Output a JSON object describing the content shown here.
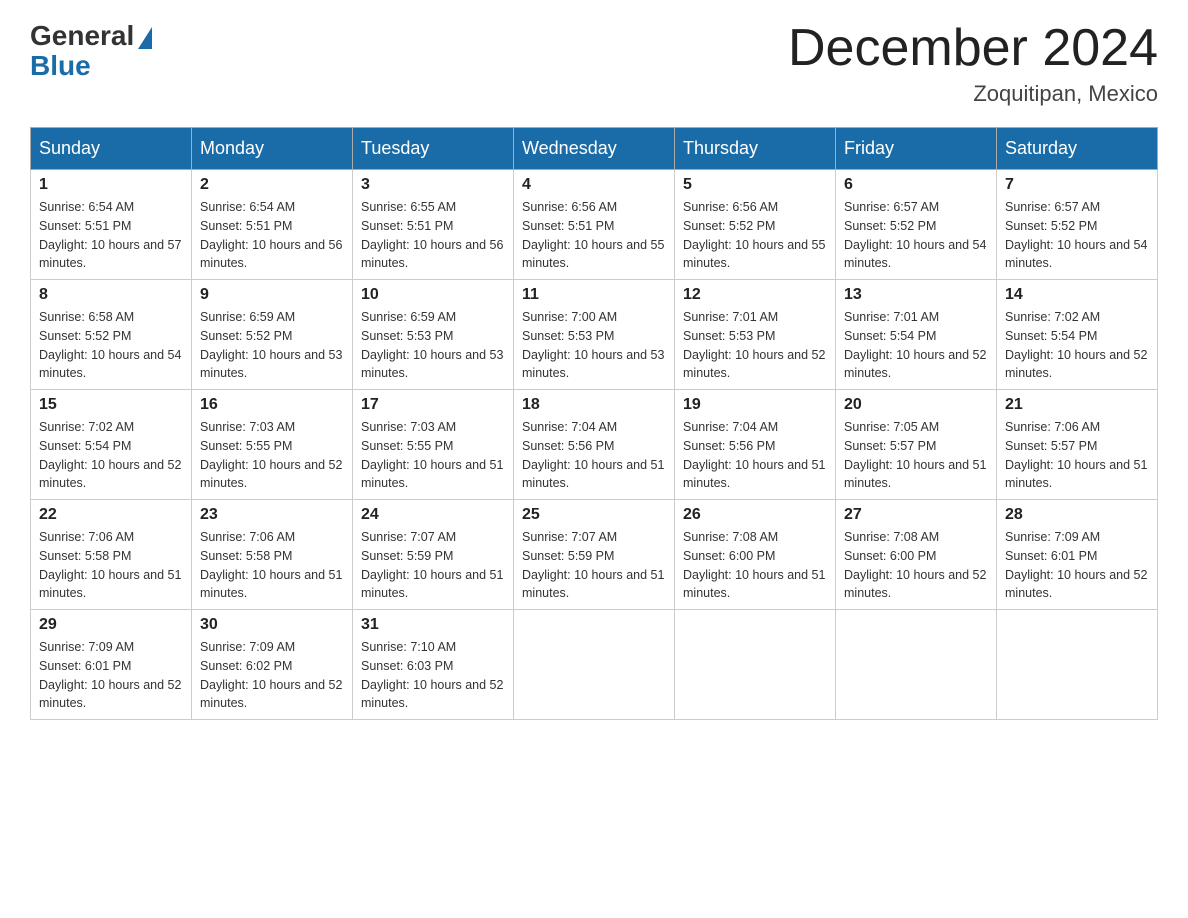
{
  "header": {
    "logo_general": "General",
    "logo_blue": "Blue",
    "month_title": "December 2024",
    "location": "Zoquitipan, Mexico"
  },
  "days_of_week": [
    "Sunday",
    "Monday",
    "Tuesday",
    "Wednesday",
    "Thursday",
    "Friday",
    "Saturday"
  ],
  "weeks": [
    [
      {
        "day": "1",
        "sunrise": "6:54 AM",
        "sunset": "5:51 PM",
        "daylight": "10 hours and 57 minutes."
      },
      {
        "day": "2",
        "sunrise": "6:54 AM",
        "sunset": "5:51 PM",
        "daylight": "10 hours and 56 minutes."
      },
      {
        "day": "3",
        "sunrise": "6:55 AM",
        "sunset": "5:51 PM",
        "daylight": "10 hours and 56 minutes."
      },
      {
        "day": "4",
        "sunrise": "6:56 AM",
        "sunset": "5:51 PM",
        "daylight": "10 hours and 55 minutes."
      },
      {
        "day": "5",
        "sunrise": "6:56 AM",
        "sunset": "5:52 PM",
        "daylight": "10 hours and 55 minutes."
      },
      {
        "day": "6",
        "sunrise": "6:57 AM",
        "sunset": "5:52 PM",
        "daylight": "10 hours and 54 minutes."
      },
      {
        "day": "7",
        "sunrise": "6:57 AM",
        "sunset": "5:52 PM",
        "daylight": "10 hours and 54 minutes."
      }
    ],
    [
      {
        "day": "8",
        "sunrise": "6:58 AM",
        "sunset": "5:52 PM",
        "daylight": "10 hours and 54 minutes."
      },
      {
        "day": "9",
        "sunrise": "6:59 AM",
        "sunset": "5:52 PM",
        "daylight": "10 hours and 53 minutes."
      },
      {
        "day": "10",
        "sunrise": "6:59 AM",
        "sunset": "5:53 PM",
        "daylight": "10 hours and 53 minutes."
      },
      {
        "day": "11",
        "sunrise": "7:00 AM",
        "sunset": "5:53 PM",
        "daylight": "10 hours and 53 minutes."
      },
      {
        "day": "12",
        "sunrise": "7:01 AM",
        "sunset": "5:53 PM",
        "daylight": "10 hours and 52 minutes."
      },
      {
        "day": "13",
        "sunrise": "7:01 AM",
        "sunset": "5:54 PM",
        "daylight": "10 hours and 52 minutes."
      },
      {
        "day": "14",
        "sunrise": "7:02 AM",
        "sunset": "5:54 PM",
        "daylight": "10 hours and 52 minutes."
      }
    ],
    [
      {
        "day": "15",
        "sunrise": "7:02 AM",
        "sunset": "5:54 PM",
        "daylight": "10 hours and 52 minutes."
      },
      {
        "day": "16",
        "sunrise": "7:03 AM",
        "sunset": "5:55 PM",
        "daylight": "10 hours and 52 minutes."
      },
      {
        "day": "17",
        "sunrise": "7:03 AM",
        "sunset": "5:55 PM",
        "daylight": "10 hours and 51 minutes."
      },
      {
        "day": "18",
        "sunrise": "7:04 AM",
        "sunset": "5:56 PM",
        "daylight": "10 hours and 51 minutes."
      },
      {
        "day": "19",
        "sunrise": "7:04 AM",
        "sunset": "5:56 PM",
        "daylight": "10 hours and 51 minutes."
      },
      {
        "day": "20",
        "sunrise": "7:05 AM",
        "sunset": "5:57 PM",
        "daylight": "10 hours and 51 minutes."
      },
      {
        "day": "21",
        "sunrise": "7:06 AM",
        "sunset": "5:57 PM",
        "daylight": "10 hours and 51 minutes."
      }
    ],
    [
      {
        "day": "22",
        "sunrise": "7:06 AM",
        "sunset": "5:58 PM",
        "daylight": "10 hours and 51 minutes."
      },
      {
        "day": "23",
        "sunrise": "7:06 AM",
        "sunset": "5:58 PM",
        "daylight": "10 hours and 51 minutes."
      },
      {
        "day": "24",
        "sunrise": "7:07 AM",
        "sunset": "5:59 PM",
        "daylight": "10 hours and 51 minutes."
      },
      {
        "day": "25",
        "sunrise": "7:07 AM",
        "sunset": "5:59 PM",
        "daylight": "10 hours and 51 minutes."
      },
      {
        "day": "26",
        "sunrise": "7:08 AM",
        "sunset": "6:00 PM",
        "daylight": "10 hours and 51 minutes."
      },
      {
        "day": "27",
        "sunrise": "7:08 AM",
        "sunset": "6:00 PM",
        "daylight": "10 hours and 52 minutes."
      },
      {
        "day": "28",
        "sunrise": "7:09 AM",
        "sunset": "6:01 PM",
        "daylight": "10 hours and 52 minutes."
      }
    ],
    [
      {
        "day": "29",
        "sunrise": "7:09 AM",
        "sunset": "6:01 PM",
        "daylight": "10 hours and 52 minutes."
      },
      {
        "day": "30",
        "sunrise": "7:09 AM",
        "sunset": "6:02 PM",
        "daylight": "10 hours and 52 minutes."
      },
      {
        "day": "31",
        "sunrise": "7:10 AM",
        "sunset": "6:03 PM",
        "daylight": "10 hours and 52 minutes."
      },
      null,
      null,
      null,
      null
    ]
  ]
}
